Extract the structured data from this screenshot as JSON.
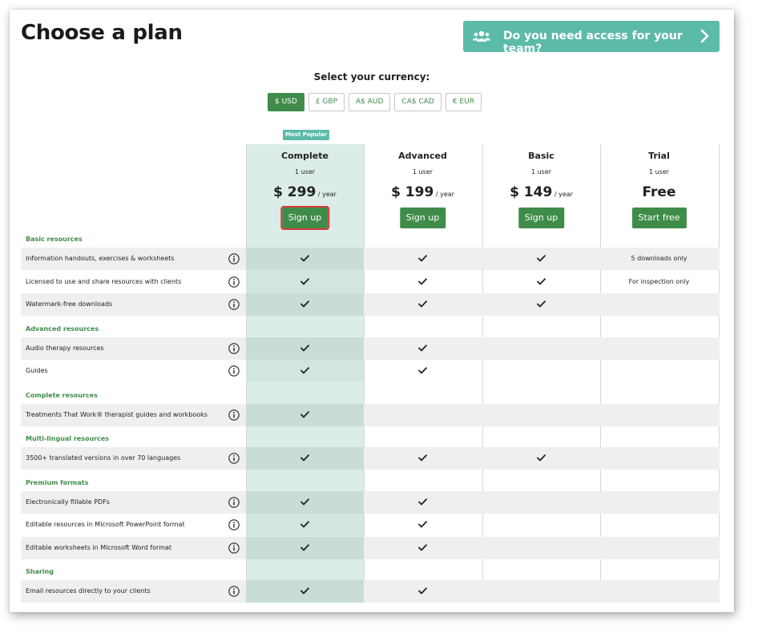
{
  "header": {
    "title": "Choose a plan",
    "team_button": "Do you need access for your team?"
  },
  "currency": {
    "label": "Select your currency:",
    "options": [
      "$ USD",
      "£ GBP",
      "A$ AUD",
      "CA$ CAD",
      "€ EUR"
    ],
    "selected": "$ USD"
  },
  "badge": "Most Popular",
  "plans": [
    {
      "name": "Complete",
      "users": "1 user",
      "price": "$ 299",
      "period": "/ year",
      "button": "Sign up"
    },
    {
      "name": "Advanced",
      "users": "1 user",
      "price": "$ 199",
      "period": "/ year",
      "button": "Sign up"
    },
    {
      "name": "Basic",
      "users": "1 user",
      "price": "$ 149",
      "period": "/ year",
      "button": "Sign up"
    },
    {
      "name": "Trial",
      "users": "1 user",
      "price": "Free",
      "period": "",
      "button": "Start free"
    }
  ],
  "sections": [
    {
      "title": "Basic resources",
      "features": [
        {
          "label": "Information handouts, exercises & worksheets",
          "cells": [
            "check",
            "check",
            "check",
            "5 downloads only"
          ]
        },
        {
          "label": "Licensed to use and share resources with clients",
          "cells": [
            "check",
            "check",
            "check",
            "For inspection only"
          ]
        },
        {
          "label": "Watermark-free downloads",
          "cells": [
            "check",
            "check",
            "check",
            ""
          ]
        }
      ]
    },
    {
      "title": "Advanced resources",
      "features": [
        {
          "label": "Audio therapy resources",
          "cells": [
            "check",
            "check",
            "",
            ""
          ]
        },
        {
          "label": "Guides",
          "cells": [
            "check",
            "check",
            "",
            ""
          ]
        }
      ]
    },
    {
      "title": "Complete resources",
      "features": [
        {
          "label": "Treatments That Work® therapist guides and workbooks",
          "cells": [
            "check",
            "",
            "",
            ""
          ]
        }
      ]
    },
    {
      "title": "Multi-lingual resources",
      "features": [
        {
          "label": "3500+ translated versions in over 70 languages",
          "cells": [
            "check",
            "check",
            "check",
            ""
          ]
        }
      ]
    },
    {
      "title": "Premium formats",
      "features": [
        {
          "label": "Electronically fillable PDFs",
          "cells": [
            "check",
            "check",
            "",
            ""
          ]
        },
        {
          "label": "Editable resources in Microsoft PowerPoint format",
          "cells": [
            "check",
            "check",
            "",
            ""
          ]
        },
        {
          "label": "Editable worksheets in Microsoft Word format",
          "cells": [
            "check",
            "check",
            "",
            ""
          ]
        }
      ]
    },
    {
      "title": "Sharing",
      "features": [
        {
          "label": "Email resources directly to your clients",
          "cells": [
            "check",
            "check",
            "",
            ""
          ]
        }
      ]
    }
  ],
  "colors": {
    "accent_green": "#3f8c4a",
    "teal": "#5bbba8",
    "popular_bg": "#dcece8",
    "highlight_border": "#d63a3a"
  }
}
